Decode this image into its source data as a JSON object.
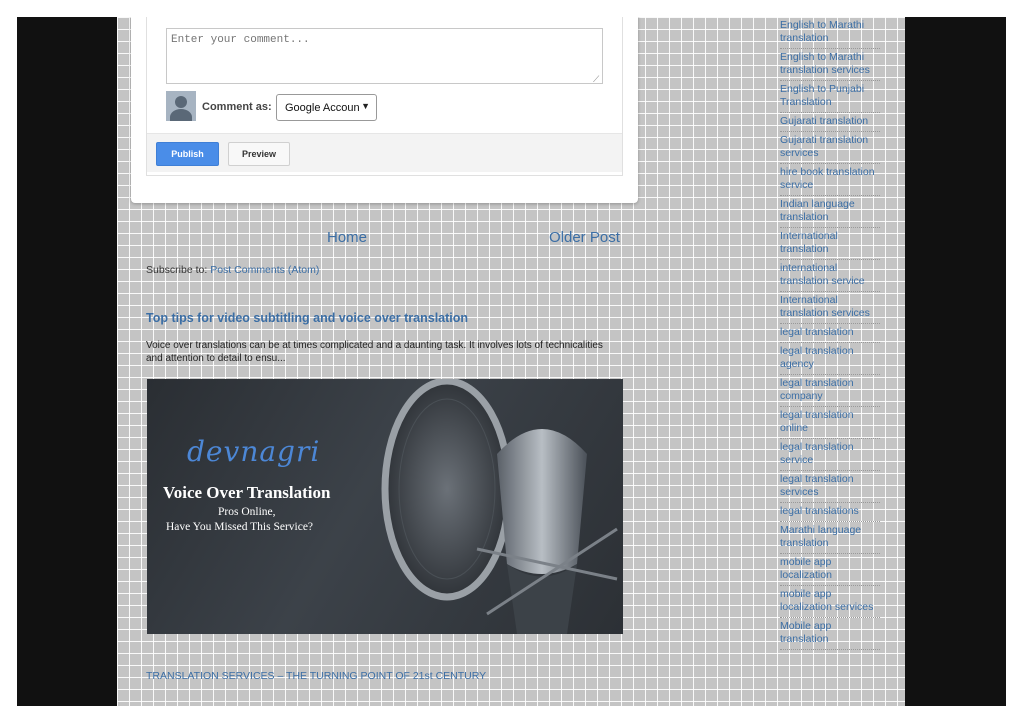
{
  "comment_form": {
    "placeholder": "Enter your comment...",
    "comment_as_label": "Comment as:",
    "account_selected": "Google Accoun",
    "publish_label": "Publish",
    "preview_label": "Preview"
  },
  "pager": {
    "home": "Home",
    "older": "Older Post"
  },
  "subscribe": {
    "prefix": "Subscribe to:",
    "link": "Post Comments (Atom)"
  },
  "post": {
    "title": "Top tips for video subtitling and voice over translation",
    "snippet": "Voice over translations can be at times complicated and a daunting task. It involves lots of technicalities and attention to detail to ensu...",
    "image": {
      "brand": "devnagri",
      "heading": "Voice Over Translation",
      "sub1": "Pros Online,",
      "sub2": "Have You Missed This Service?"
    }
  },
  "bottom_link": "TRANSLATION SERVICES – THE TURNING POINT OF 21st CENTURY",
  "sidebar": {
    "labels": [
      "English to Marathi translation",
      "English to Marathi translation services",
      "English to Punjabi Translation",
      "Gujarati translation",
      "Gujarati translation services",
      "hire book translation service",
      "Indian language translation",
      "International translation",
      "international translation service",
      "International translation services",
      "legal translation",
      "legal translation agency",
      "legal translation company",
      "legal translation online",
      "legal translation service",
      "legal translation services",
      "legal translations",
      "Marathi language translation",
      "mobile app localization",
      "mobile app localization services",
      "Mobile app translation"
    ]
  },
  "colors": {
    "link": "#3b6ea5",
    "publish": "#4a8de8",
    "frame": "#111111"
  }
}
